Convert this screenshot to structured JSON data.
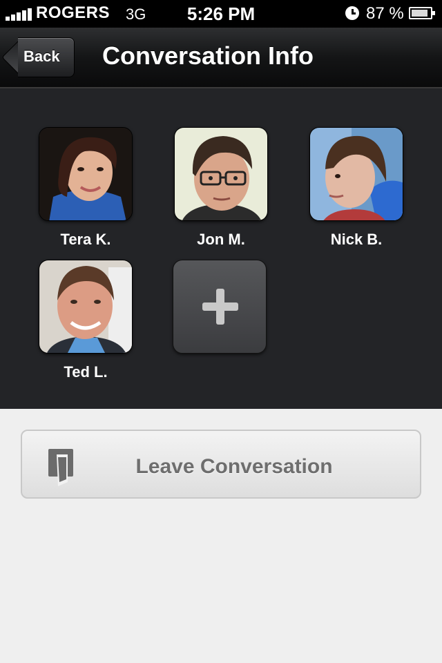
{
  "status_bar": {
    "carrier": "ROGERS",
    "network": "3G",
    "time": "5:26 PM",
    "battery_percent": "87 %",
    "battery_level": 0.87
  },
  "nav": {
    "back_label": "Back",
    "title": "Conversation Info"
  },
  "participants": [
    {
      "name": "Tera K.",
      "avatar": "avatar-photo"
    },
    {
      "name": "Jon M.",
      "avatar": "avatar-photo"
    },
    {
      "name": "Nick B.",
      "avatar": "avatar-photo"
    },
    {
      "name": "Ted L.",
      "avatar": "avatar-photo"
    }
  ],
  "add_button": {
    "icon": "plus-icon"
  },
  "leave": {
    "label": "Leave Conversation",
    "icon": "door-exit-icon"
  }
}
